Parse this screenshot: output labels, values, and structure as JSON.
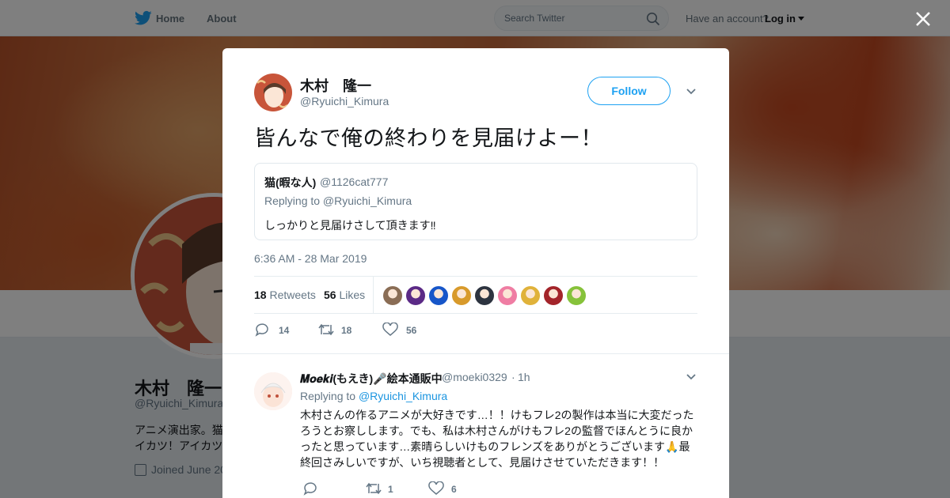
{
  "nav": {
    "home": "Home",
    "about": "About",
    "search_placeholder": "Search Twitter",
    "have_account": "Have an account?",
    "login": "Log in"
  },
  "profile": {
    "name": "木村　隆一",
    "handle": "@Ryuichi_Kimura",
    "bio_line1": "アニメ演出家。猫",
    "bio_line2": "イカツ！アイカツ",
    "joined": "Joined June 20"
  },
  "tweet": {
    "author_name": "木村　隆一",
    "author_handle": "@Ryuichi_Kimura",
    "follow_label": "Follow",
    "text": "皆んなで俺の終わりを見届けよー！",
    "quote": {
      "name": "猫(暇な人)",
      "handle": "@1126cat777",
      "replying_to": "Replying to @Ryuichi_Kimura",
      "text": "しっかりと見届けさして頂きます‼"
    },
    "timestamp": "6:36 AM - 28 Mar 2019",
    "retweets_count": "18",
    "retweets_label": "Retweets",
    "likes_count": "56",
    "likes_label": "Likes",
    "actions": {
      "replies": "14",
      "retweets": "18",
      "likes": "56"
    }
  },
  "reply": {
    "name": "𝑴𝒐𝒆𝒌𝒊(もえき)🎤絵本通販中",
    "handle": "@moeki0329",
    "dot": "·",
    "time": "1h",
    "replying_prefix": "Replying to ",
    "replying_handle": "@Ryuichi_Kimura",
    "text": "木村さんの作るアニメが大好きです…！！けもフレ2の製作は本当に大変だったろうとお察しします。でも、私は木村さんがけもフレ2の監督でほんとうに良かったと思っています…素晴らしいけものフレンズをありがとうございます🙏最終回さみしいですが、いち視聴者として、見届けさせていただきます！！",
    "actions": {
      "replies": "",
      "retweets": "1",
      "likes": "6"
    }
  },
  "colors": {
    "accent": "#1da1f2",
    "link": "#1b95e0",
    "muted": "#657786",
    "text": "#14171a"
  },
  "likers": [
    {
      "icon": "liker-avatar-1",
      "color": "#8a6d55"
    },
    {
      "icon": "liker-avatar-2",
      "color": "#5b2a86"
    },
    {
      "icon": "liker-avatar-3",
      "color": "#1756c9"
    },
    {
      "icon": "liker-avatar-4",
      "color": "#d89a2b"
    },
    {
      "icon": "liker-avatar-5",
      "color": "#2d3440"
    },
    {
      "icon": "liker-avatar-6",
      "color": "#ef7da3"
    },
    {
      "icon": "liker-avatar-7",
      "color": "#e0b23a"
    },
    {
      "icon": "liker-avatar-8",
      "color": "#a3242a"
    },
    {
      "icon": "liker-avatar-9",
      "color": "#86c23a"
    }
  ]
}
